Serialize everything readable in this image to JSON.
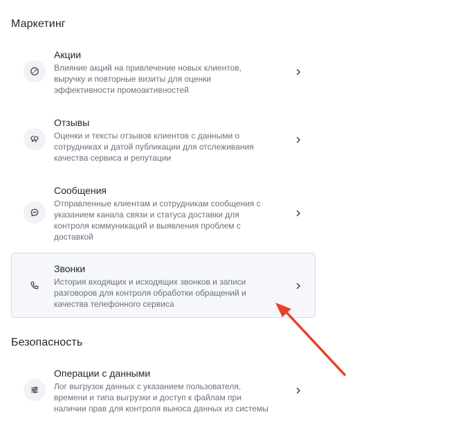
{
  "sections": [
    {
      "title": "Маркетинг",
      "items": [
        {
          "title": "Акции",
          "icon": "promo-gauge-icon",
          "description": "Влияние акций на привлечение новых клиентов, выручку и повторные визиты для оценки эффективности промоактивностей"
        },
        {
          "title": "Отзывы",
          "icon": "review-feedback-icon",
          "description": "Оценки и тексты отзывов клиентов с данными о сотрудниках и датой публикации для отслеживания качества сервиса и репутации"
        },
        {
          "title": "Сообщения",
          "icon": "message-bubble-icon",
          "description": "Отправленные клиентам и сотрудникам сообщения с указанием канала связи и статуса доставки для контроля коммуникаций и выявления проблем с доставкой"
        },
        {
          "title": "Звонки",
          "icon": "phone-icon",
          "description": "История входящих и исходящих звонков и записи разговоров для контроля обработки обращений и качества телефонного сервиса",
          "highlighted": true
        }
      ]
    },
    {
      "title": "Безопасность",
      "items": [
        {
          "title": "Операции с данными",
          "icon": "sliders-icon",
          "description": "Лог выгрузок данных с указанием пользователя, времени и типа выгрузки и доступ к файлам при наличии прав для контроля выноса данных из системы"
        }
      ]
    }
  ],
  "annotation": {
    "arrow_color": "#e8432a"
  }
}
